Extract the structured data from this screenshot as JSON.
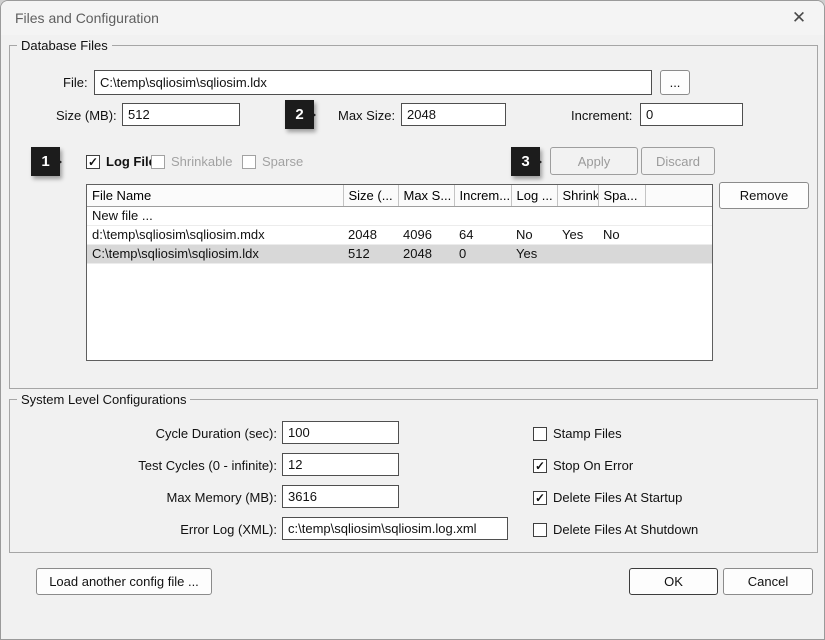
{
  "window": {
    "title": "Files and Configuration",
    "close_icon": "✕"
  },
  "callouts": {
    "one": "1",
    "two": "2",
    "three": "3"
  },
  "database_files": {
    "group_label": "Database Files",
    "file_label": "File:",
    "file_value": "C:\\temp\\sqliosim\\sqliosim.ldx",
    "browse_label": "...",
    "size_label": "Size (MB):",
    "size_value": "512",
    "max_size_label": "Max Size:",
    "max_size_value": "2048",
    "increment_label": "Increment:",
    "increment_value": "0",
    "log_file": {
      "label": "Log File",
      "checked": true
    },
    "shrinkable": {
      "label": "Shrinkable",
      "checked": false
    },
    "sparse": {
      "label": "Sparse",
      "checked": false
    },
    "apply_label": "Apply",
    "discard_label": "Discard",
    "remove_label": "Remove",
    "table": {
      "columns": [
        "File Name",
        "Size (...",
        "Max S...",
        "Increm...",
        "Log ...",
        "Shrink",
        "Spa...",
        ""
      ],
      "rows": [
        {
          "selected": false,
          "cells": [
            "New file ...",
            "",
            "",
            "",
            "",
            "",
            "",
            ""
          ]
        },
        {
          "selected": false,
          "cells": [
            "d:\\temp\\sqliosim\\sqliosim.mdx",
            "2048",
            "4096",
            "64",
            "No",
            "Yes",
            "No",
            ""
          ]
        },
        {
          "selected": true,
          "cells": [
            "C:\\temp\\sqliosim\\sqliosim.ldx",
            "512",
            "2048",
            "0",
            "Yes",
            "",
            "",
            ""
          ]
        }
      ]
    }
  },
  "system_config": {
    "group_label": "System Level Configurations",
    "fields": [
      {
        "label": "Cycle Duration (sec):",
        "value": "100"
      },
      {
        "label": "Test Cycles (0 - infinite):",
        "value": "12"
      },
      {
        "label": "Max Memory (MB):",
        "value": "3616"
      },
      {
        "label": "Error Log (XML):",
        "value": "c:\\temp\\sqliosim\\sqliosim.log.xml"
      }
    ],
    "checkboxes": [
      {
        "label": "Stamp Files",
        "checked": false
      },
      {
        "label": "Stop On Error",
        "checked": true
      },
      {
        "label": "Delete Files At Startup",
        "checked": true
      },
      {
        "label": "Delete Files At Shutdown",
        "checked": false
      }
    ]
  },
  "footer": {
    "load_config_label": "Load another config file ...",
    "ok_label": "OK",
    "cancel_label": "Cancel"
  }
}
